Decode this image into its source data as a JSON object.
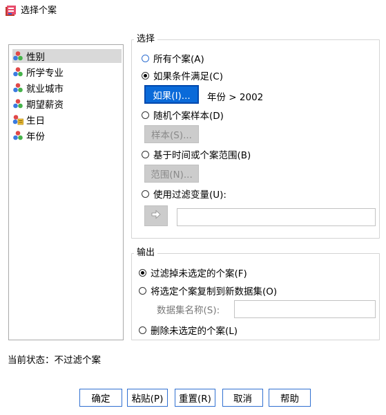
{
  "window": {
    "title": "选择个案",
    "icon": "spss-dialog-icon"
  },
  "variables": [
    {
      "label": "性别",
      "icon": "nominal-variable-icon",
      "selected": true
    },
    {
      "label": "所学专业",
      "icon": "nominal-variable-icon",
      "selected": false
    },
    {
      "label": "就业城市",
      "icon": "nominal-variable-icon",
      "selected": false
    },
    {
      "label": "期望薪资",
      "icon": "nominal-variable-icon",
      "selected": false
    },
    {
      "label": "生日",
      "icon": "date-variable-icon",
      "selected": false
    },
    {
      "label": "年份",
      "icon": "nominal-variable-icon",
      "selected": false
    }
  ],
  "select_group": {
    "legend": "选择",
    "options": {
      "all": "所有个案(A)",
      "if_condition": "如果条件满足(C)",
      "random": "随机个案样本(D)",
      "range": "基于时间或个案范围(B)",
      "filter_var": "使用过滤变量(U):"
    },
    "selected": "if_condition",
    "if_button": "如果(I)...",
    "condition_text": "年份 > 2002",
    "sample_button": "样本(S)...",
    "range_button": "范围(N)...",
    "move_button_icon": "arrow-right-icon",
    "filter_var_value": ""
  },
  "output_group": {
    "legend": "输出",
    "options": {
      "filter_out": "过滤掉未选定的个案(F)",
      "copy_to_dataset": "将选定个案复制到新数据集(O)",
      "delete": "删除未选定的个案(L)"
    },
    "selected": "filter_out",
    "dataset_name_label": "数据集名称(S):",
    "dataset_name_value": ""
  },
  "status": {
    "text": "当前状态：不过滤个案"
  },
  "buttons": {
    "ok": "确定",
    "paste": "粘贴(P)",
    "reset": "重置(R)",
    "cancel": "取消",
    "help": "帮助"
  }
}
